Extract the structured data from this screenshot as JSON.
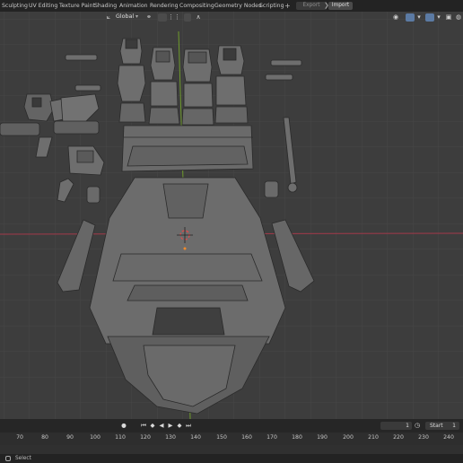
{
  "workspace_tabs": [
    {
      "label": "Sculpting"
    },
    {
      "label": "UV Editing"
    },
    {
      "label": "Texture Paint"
    },
    {
      "label": "Shading"
    },
    {
      "label": "Animation"
    },
    {
      "label": "Rendering"
    },
    {
      "label": "Compositing"
    },
    {
      "label": "Geometry Nodes"
    },
    {
      "label": "Scripting"
    }
  ],
  "add_workspace": "+",
  "top_buttons": {
    "export": "Export",
    "import": "Import"
  },
  "viewport": {
    "orientation": "Global",
    "icons": [
      "transform-orientation-icon",
      "pivot-icon",
      "snap-icon",
      "proportional-edit-icon",
      "visibility-icon",
      "gizmo-icon",
      "overlay-icon",
      "xray-icon",
      "shading-solid-icon"
    ],
    "colors": {
      "background": "#3d3d3d",
      "x_axis": "#a3394a",
      "y_axis": "#6f9b2c",
      "mesh": "#6f6f6f"
    }
  },
  "timeline": {
    "current_frame": "1",
    "start_label": "Start",
    "start_value": "1",
    "ruler": [
      "70",
      "80",
      "90",
      "100",
      "110",
      "120",
      "130",
      "140",
      "150",
      "160",
      "170",
      "180",
      "190",
      "200",
      "210",
      "220",
      "230",
      "240"
    ]
  },
  "status_bar": {
    "text": "Select"
  }
}
